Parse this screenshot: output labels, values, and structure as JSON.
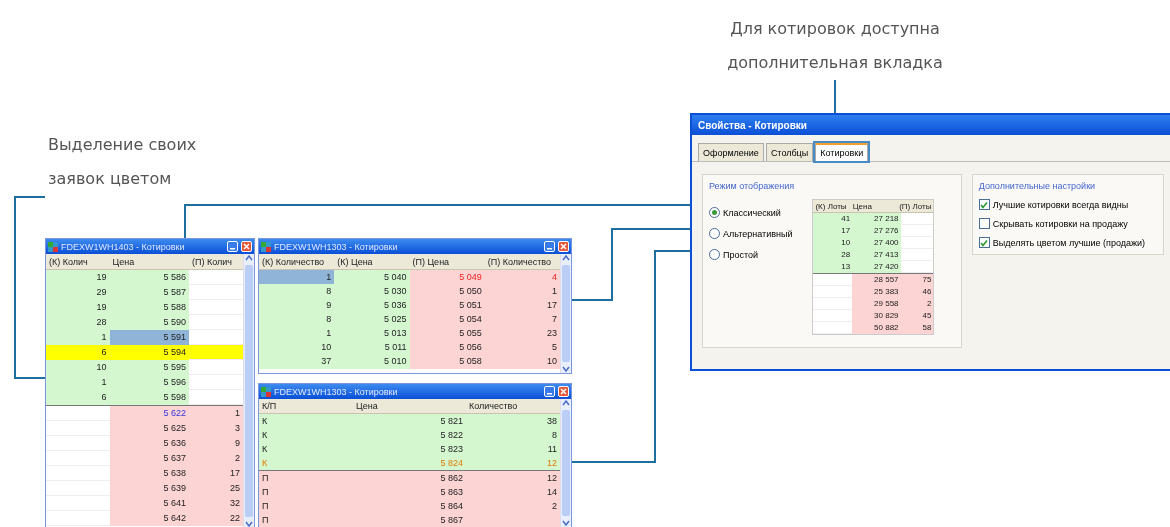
{
  "captions": [
    {
      "kind": "left",
      "lines": [
        "Выделение своих",
        "заявок цветом"
      ]
    },
    {
      "kind": "top",
      "lines": [
        "Для котировок доступна",
        "дополнительная вкладка"
      ]
    }
  ],
  "windows": [
    {
      "title": "FDEXW1WH1403 - Котировки",
      "kind": "ladder",
      "columns": [
        "(К) Колич",
        "Цена",
        "(П) Колич"
      ],
      "rows": [
        {
          "kind": "buy",
          "own": false,
          "cells": [
            "19",
            "5 586",
            ""
          ]
        },
        {
          "kind": "buy",
          "own": false,
          "cells": [
            "29",
            "5 587",
            ""
          ]
        },
        {
          "kind": "buy",
          "own": false,
          "cells": [
            "19",
            "5 588",
            ""
          ]
        },
        {
          "kind": "buy",
          "own": false,
          "cells": [
            "28",
            "5 590",
            ""
          ]
        },
        {
          "kind": "buy",
          "own": false,
          "cells": [
            "1",
            {
              "text": "5 591",
              "selected": true
            },
            ""
          ]
        },
        {
          "kind": "buy",
          "own": true,
          "cells": [
            "6",
            "5 594",
            ""
          ]
        },
        {
          "kind": "buy",
          "own": false,
          "cells": [
            "10",
            "5 595",
            ""
          ]
        },
        {
          "kind": "buy",
          "own": false,
          "cells": [
            "1",
            "5 596",
            ""
          ]
        },
        {
          "kind": "buy",
          "own": false,
          "cells": [
            "6",
            "5 598",
            ""
          ]
        },
        {
          "kind": "sell",
          "own": false,
          "cells": [
            "",
            {
              "text": "5 622",
              "highlight": true
            },
            "1"
          ]
        },
        {
          "kind": "sell",
          "own": false,
          "cells": [
            "",
            "5 625",
            "3"
          ]
        },
        {
          "kind": "sell",
          "own": false,
          "cells": [
            "",
            "5 636",
            "9"
          ]
        },
        {
          "kind": "sell",
          "own": false,
          "cells": [
            "",
            "5 637",
            "2"
          ]
        },
        {
          "kind": "sell",
          "own": false,
          "cells": [
            "",
            "5 638",
            "17"
          ]
        },
        {
          "kind": "sell",
          "own": false,
          "cells": [
            "",
            "5 639",
            "25"
          ]
        },
        {
          "kind": "sell",
          "own": false,
          "cells": [
            "",
            "5 641",
            "32"
          ]
        },
        {
          "kind": "sell",
          "own": false,
          "cells": [
            "",
            "5 642",
            "22"
          ]
        }
      ]
    },
    {
      "title": "FDEXW1WH1303 - Котировки",
      "kind": "split",
      "columns": [
        "(К) Количество",
        "(К) Цена",
        "(П) Цена",
        "(П) Количество"
      ],
      "rows": [
        {
          "kind": "buy",
          "own": false,
          "cells": [
            {
              "text": "1",
              "selected": true
            },
            "5 040",
            {
              "text": "5 049",
              "highlight": true
            },
            {
              "text": "4",
              "highlight": true
            }
          ]
        },
        {
          "kind": "buy",
          "own": false,
          "cells": [
            "8",
            "5 030",
            "5 050",
            "1"
          ]
        },
        {
          "kind": "buy",
          "own": false,
          "cells": [
            "9",
            "5 036",
            "5 051",
            "17"
          ]
        },
        {
          "kind": "buy",
          "own": false,
          "cells": [
            "8",
            "5 025",
            "5 054",
            "7"
          ]
        },
        {
          "kind": "buy",
          "own": false,
          "cells": [
            "1",
            "5 013",
            "5 055",
            "23"
          ]
        },
        {
          "kind": "buy",
          "own": false,
          "cells": [
            "10",
            "5 011",
            "5 056",
            "5"
          ]
        },
        {
          "kind": "buy",
          "own": false,
          "cells": [
            "37",
            "5 010",
            "5 058",
            "10"
          ]
        }
      ]
    },
    {
      "title": "FDEXW1WH1303 - Котировки",
      "kind": "list",
      "columns": [
        "К/П",
        "Цена",
        "Количество"
      ],
      "rows": [
        {
          "kind": "buy",
          "own": false,
          "cells": [
            "К",
            "5 821",
            "38"
          ]
        },
        {
          "kind": "buy",
          "own": false,
          "cells": [
            "К",
            "5 822",
            "8"
          ]
        },
        {
          "kind": "buy",
          "own": false,
          "cells": [
            "К",
            "5 823",
            "11"
          ]
        },
        {
          "kind": "buy",
          "own": true,
          "cells": [
            "К",
            "5 824",
            "12"
          ]
        },
        {
          "kind": "sell",
          "own": false,
          "cells": [
            "П",
            "5 862",
            "12"
          ]
        },
        {
          "kind": "sell",
          "own": false,
          "cells": [
            "П",
            "5 863",
            "14"
          ]
        },
        {
          "kind": "sell",
          "own": false,
          "cells": [
            "П",
            "5 864",
            "2"
          ]
        },
        {
          "kind": "sell",
          "own": false,
          "cells": [
            "П",
            "5 867",
            ""
          ]
        }
      ]
    }
  ],
  "dialog": {
    "title": "Свойства - Котировки",
    "tabs": [
      {
        "label": "Оформление",
        "selected": false
      },
      {
        "label": "Столбцы",
        "selected": false
      },
      {
        "label": "Котировки",
        "selected": true
      }
    ],
    "mode_group": {
      "title": "Режим отображения",
      "options": [
        {
          "label": "Классический",
          "selected": true
        },
        {
          "label": "Альтернативный",
          "selected": false
        },
        {
          "label": "Простой",
          "selected": false
        }
      ],
      "preview": {
        "kind": "ladder",
        "columns": [
          "(К) Лоты",
          "Цена",
          "(П) Лоты"
        ],
        "rows": [
          {
            "kind": "buy",
            "own": false,
            "cells": [
              "41",
              "27 218",
              ""
            ]
          },
          {
            "kind": "buy",
            "own": false,
            "cells": [
              "17",
              "27 276",
              ""
            ]
          },
          {
            "kind": "buy",
            "own": false,
            "cells": [
              "10",
              "27 400",
              ""
            ]
          },
          {
            "kind": "buy",
            "own": false,
            "cells": [
              "28",
              "27 413",
              ""
            ]
          },
          {
            "kind": "buy",
            "own": false,
            "cells": [
              "13",
              "27 420",
              ""
            ]
          },
          {
            "kind": "sell",
            "own": false,
            "cells": [
              "",
              "28 557",
              "75"
            ]
          },
          {
            "kind": "sell",
            "own": false,
            "cells": [
              "",
              "25 383",
              "46"
            ]
          },
          {
            "kind": "sell",
            "own": false,
            "cells": [
              "",
              "29 558",
              "2"
            ]
          },
          {
            "kind": "sell",
            "own": false,
            "cells": [
              "",
              "30 829",
              "45"
            ]
          },
          {
            "kind": "sell",
            "own": false,
            "cells": [
              "",
              "50 882",
              "58"
            ]
          }
        ]
      }
    },
    "extra_group": {
      "title": "Дополнительные настройки",
      "options": [
        {
          "label": "Лучшие котировки всегда видны",
          "checked": true
        },
        {
          "label": "Скрывать котировки на продажу",
          "checked": false
        },
        {
          "label": "Выделять цветом лучшие (продажи)",
          "checked": true
        }
      ]
    }
  }
}
